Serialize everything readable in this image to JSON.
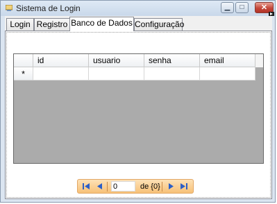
{
  "window": {
    "title": "Sistema de Login",
    "minimize_glyph": "▁",
    "maximize_glyph": "□",
    "close_glyph": "✕"
  },
  "tabs": [
    {
      "label": "Login",
      "active": false
    },
    {
      "label": "Registro",
      "active": false
    },
    {
      "label": "Banco de Dados",
      "active": true
    },
    {
      "label": "Configuração",
      "active": false
    }
  ],
  "grid": {
    "columns": [
      "id",
      "usuario",
      "senha",
      "email"
    ],
    "new_row_marker": "*",
    "new_row_values": [
      "",
      "",
      "",
      ""
    ]
  },
  "navigator": {
    "position_value": "0",
    "count_text": "de {0}",
    "icons": [
      "first-icon",
      "prev-icon",
      "next-icon",
      "last-icon"
    ]
  },
  "colors": {
    "accent_nav": "#f7c177",
    "nav_arrows": "#2b5fc7",
    "grid_background": "#ababab"
  }
}
